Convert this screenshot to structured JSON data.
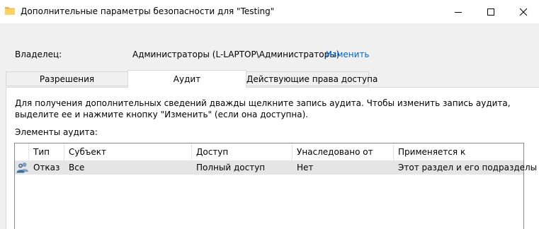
{
  "window": {
    "title": "Дополнительные параметры безопасности  для \"Testing\""
  },
  "owner": {
    "label": "Владелец:",
    "value": "Администраторы (L-LAPTOP\\Администраторы)",
    "change_link": "Изменить"
  },
  "tabs": [
    {
      "label": "Разрешения",
      "active": false
    },
    {
      "label": "Аудит",
      "active": true
    },
    {
      "label": "Действующие права доступа",
      "active": false
    }
  ],
  "audit": {
    "info_text": "Для получения дополнительных сведений дважды щелкните запись аудита. Чтобы изменить запись аудита, выделите ее и нажмите кнопку \"Изменить\" (если она доступна).",
    "entries_label": "Элементы аудита:",
    "columns": [
      "Тип",
      "Субъект",
      "Доступ",
      "Унаследовано от",
      "Применяется к"
    ],
    "rows": [
      {
        "icon": "users-icon",
        "type": "Отказ",
        "principal": "Все",
        "access": "Полный доступ",
        "inherited_from": "Нет",
        "applies_to": "Этот раздел и его подразделы"
      }
    ]
  },
  "colors": {
    "link": "#0066cc",
    "selected_row": "#e5e5e5",
    "folder": "#ffd15e"
  }
}
